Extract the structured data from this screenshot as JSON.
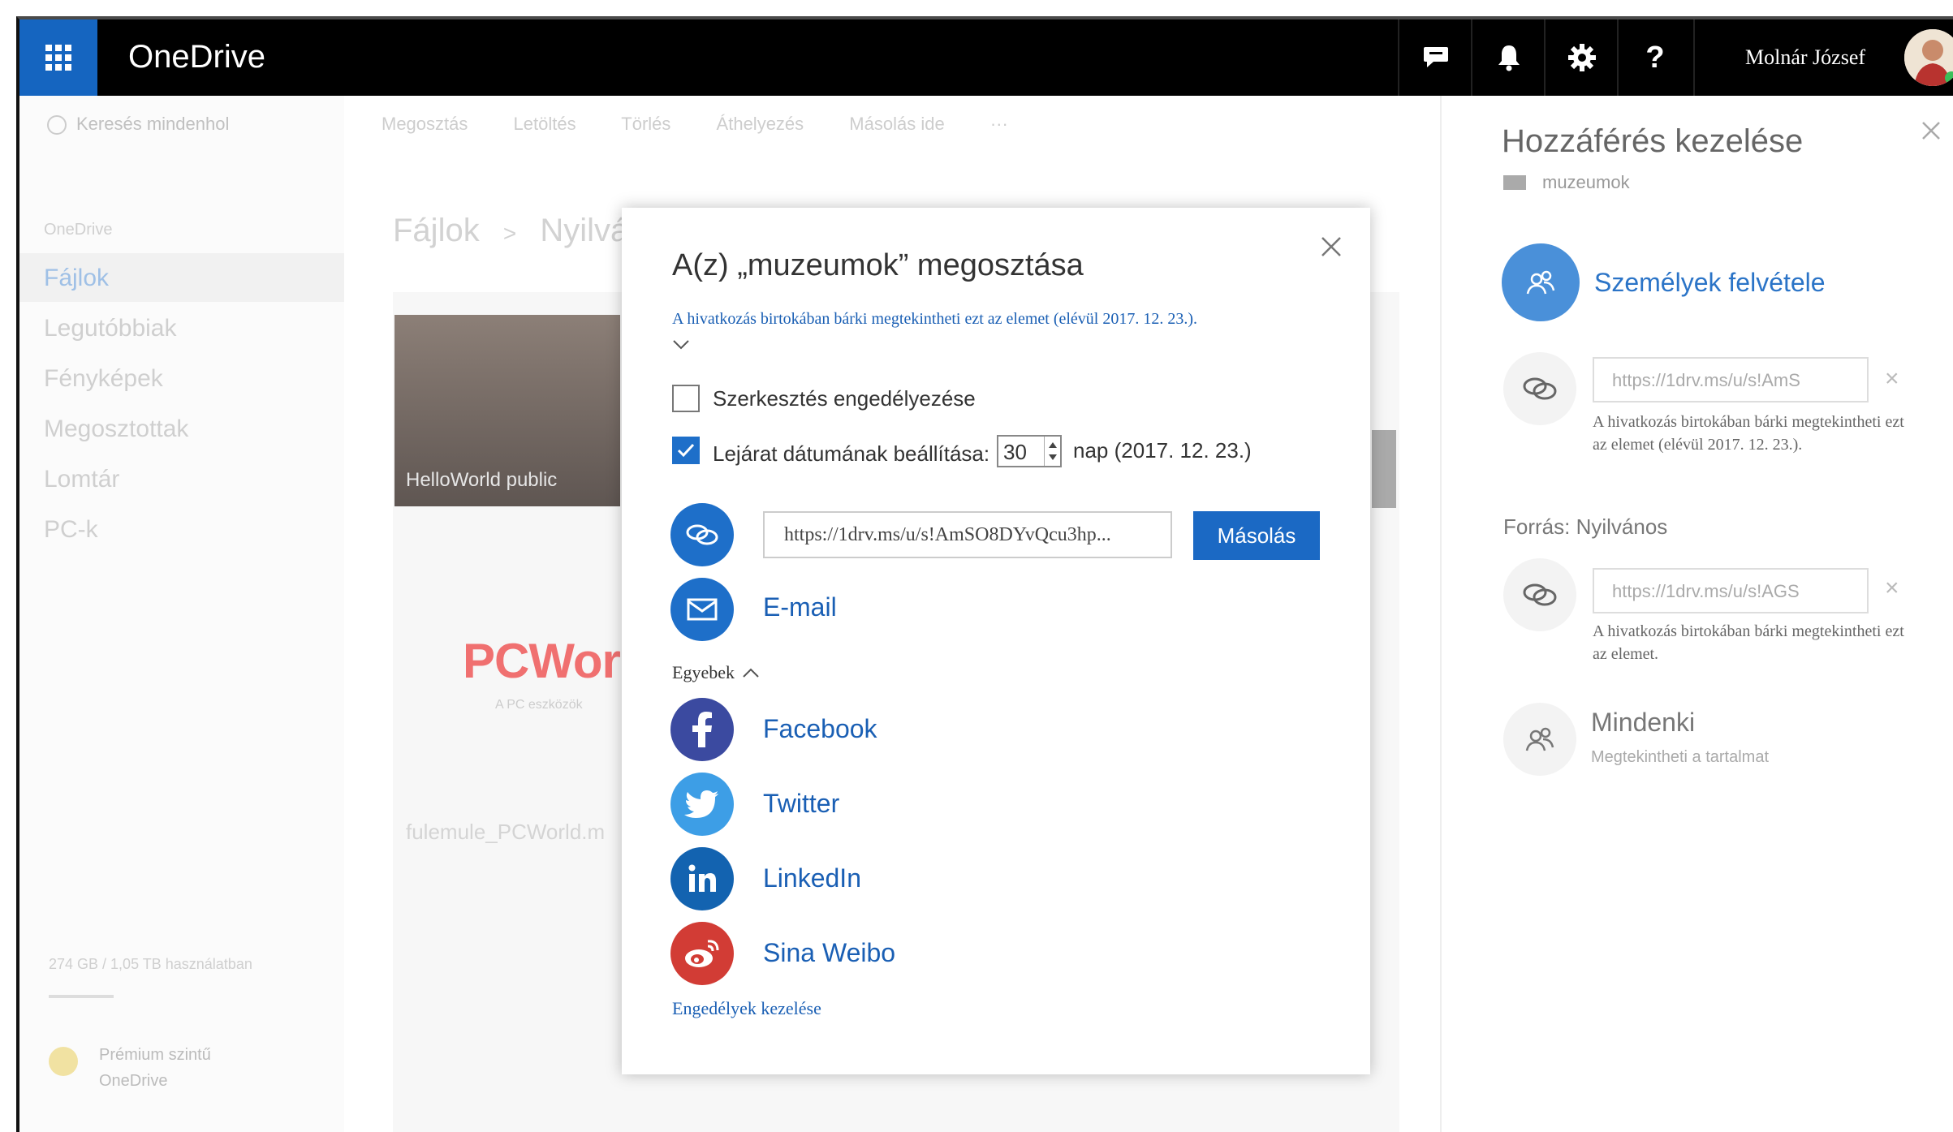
{
  "app": {
    "name": "OneDrive",
    "user_name": "Molnár József"
  },
  "topbar_icons": [
    "chat-icon",
    "bell-icon",
    "gear-icon",
    "help-icon"
  ],
  "help_glyph": "?",
  "background": {
    "search_placeholder": "Keresés mindenhol",
    "commands": [
      "Megosztás",
      "Letöltés",
      "Törlés",
      "Áthelyezés",
      "Másolás ide",
      "···"
    ],
    "breadcrumb": [
      "Fájlok",
      ">",
      "Nyilvános"
    ],
    "nav": [
      "OneDrive",
      "Fájlok",
      "Legutóbbiak",
      "Fényképek",
      "Megosztottak",
      "Lomtár",
      "PC-k"
    ],
    "thumb_label": "HelloWorld public",
    "pcworld_text": "PCWorl",
    "pcworld_sub": "A PC eszközök",
    "file_name": "fulemule_PCWorld.m",
    "storage": "274 GB / 1,05 TB használatban",
    "premium": [
      "Prémium szintű",
      "OneDrive"
    ]
  },
  "dialog": {
    "title": "A(z) „muzeumok” megosztása",
    "description": "A hivatkozás birtokában bárki megtekintheti ezt az elemet (elévül 2017. 12. 23.).",
    "allow_edit_label": "Szerkesztés engedélyezése",
    "allow_edit_checked": false,
    "expiry_label": "Lejárat dátumának beállítása:",
    "expiry_checked": true,
    "expiry_days": "30",
    "expiry_suffix": "nap (2017. 12. 23.)",
    "link_value": "https://1drv.ms/u/s!AmSO8DYvQcu3hp...",
    "copy_button": "Másolás",
    "email_label": "E-mail",
    "other_label": "Egyebek",
    "facebook_label": "Facebook",
    "twitter_label": "Twitter",
    "linkedin_label": "LinkedIn",
    "weibo_label": "Sina Weibo",
    "permissions_link": "Engedélyek kezelése"
  },
  "right_panel": {
    "title": "Hozzáférés kezelése",
    "item": "muzeumok",
    "add_people": "Személyek felvétele",
    "link1": "https://1drv.ms/u/s!AmS",
    "link1_desc": "A hivatkozás birtokában bárki megtekintheti ezt az elemet (elévül 2017. 12. 23.).",
    "source_label": "Forrás: Nyilvános",
    "link2": "https://1drv.ms/u/s!AGS",
    "link2_desc": "A hivatkozás birtokában bárki megtekintheti ezt az elemet.",
    "everyone": "Mindenki",
    "everyone_sub": "Megtekintheti a tartalmat"
  },
  "colors": {
    "accent": "#1e6fc9",
    "topbar": "#000000",
    "waffle": "#1565c0",
    "facebook": "#3b4aa0",
    "twitter": "#3d9ee6",
    "linkedin": "#1363b0",
    "weibo": "#d23c35"
  }
}
